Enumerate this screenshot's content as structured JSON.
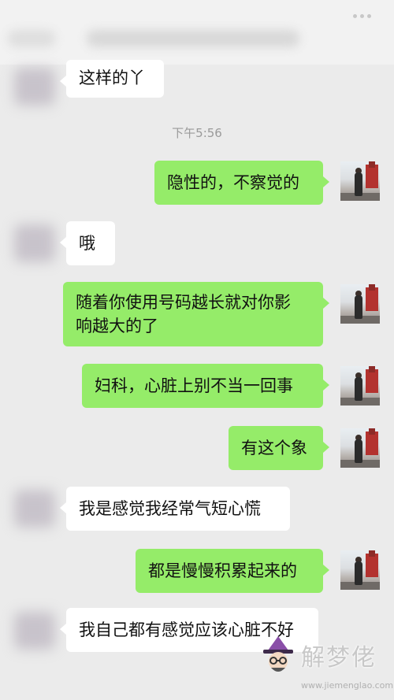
{
  "header": {
    "more_icon": "more-dots-icon"
  },
  "timestamp": "下午5:56",
  "messages": [
    {
      "side": "left",
      "text": "这样的丫"
    },
    {
      "side": "right",
      "text": "隐性的，不察觉的"
    },
    {
      "side": "left",
      "text": "哦"
    },
    {
      "side": "right",
      "line1": "随着你使用号码越长就对你影",
      "line2": "响越大的了"
    },
    {
      "side": "right",
      "text": "妇科，心脏上别不当一回事"
    },
    {
      "side": "right",
      "text": "有这个象"
    },
    {
      "side": "left",
      "text": "我是感觉我经常气短心慌"
    },
    {
      "side": "right",
      "text": "都是慢慢积累起来的"
    },
    {
      "side": "left",
      "text": "我自己都有感觉应该心脏不好"
    }
  ],
  "watermark": {
    "brand": "解梦佬",
    "url": "www.jiemenglao.com",
    "logo_icon": "wizard-hat-logo-icon"
  }
}
